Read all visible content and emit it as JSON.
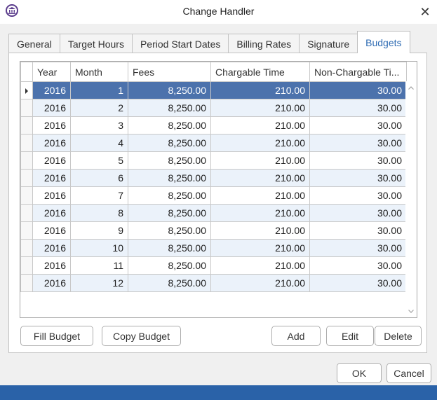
{
  "window": {
    "title": "Change Handler"
  },
  "tabs": [
    {
      "label": "General",
      "active": false
    },
    {
      "label": "Target Hours",
      "active": false
    },
    {
      "label": "Period Start Dates",
      "active": false
    },
    {
      "label": "Billing Rates",
      "active": false
    },
    {
      "label": "Signature",
      "active": false
    },
    {
      "label": "Budgets",
      "active": true
    }
  ],
  "grid": {
    "columns": [
      "Year",
      "Month",
      "Fees",
      "Chargable Time",
      "Non-Chargable Ti..."
    ],
    "selected_row": 0,
    "rows": [
      [
        "2016",
        "1",
        "8,250.00",
        "210.00",
        "30.00"
      ],
      [
        "2016",
        "2",
        "8,250.00",
        "210.00",
        "30.00"
      ],
      [
        "2016",
        "3",
        "8,250.00",
        "210.00",
        "30.00"
      ],
      [
        "2016",
        "4",
        "8,250.00",
        "210.00",
        "30.00"
      ],
      [
        "2016",
        "5",
        "8,250.00",
        "210.00",
        "30.00"
      ],
      [
        "2016",
        "6",
        "8,250.00",
        "210.00",
        "30.00"
      ],
      [
        "2016",
        "7",
        "8,250.00",
        "210.00",
        "30.00"
      ],
      [
        "2016",
        "8",
        "8,250.00",
        "210.00",
        "30.00"
      ],
      [
        "2016",
        "9",
        "8,250.00",
        "210.00",
        "30.00"
      ],
      [
        "2016",
        "10",
        "8,250.00",
        "210.00",
        "30.00"
      ],
      [
        "2016",
        "11",
        "8,250.00",
        "210.00",
        "30.00"
      ],
      [
        "2016",
        "12",
        "8,250.00",
        "210.00",
        "30.00"
      ]
    ]
  },
  "buttons": {
    "fill_budget": "Fill Budget",
    "copy_budget": "Copy Budget",
    "add": "Add",
    "edit": "Edit",
    "delete": "Delete",
    "ok": "OK",
    "cancel": "Cancel"
  },
  "colors": {
    "selected_row": "#4c72ac",
    "alt_row": "#ebf2fa",
    "active_tab_text": "#2e6bb3",
    "statusbar": "#2a62a8"
  }
}
